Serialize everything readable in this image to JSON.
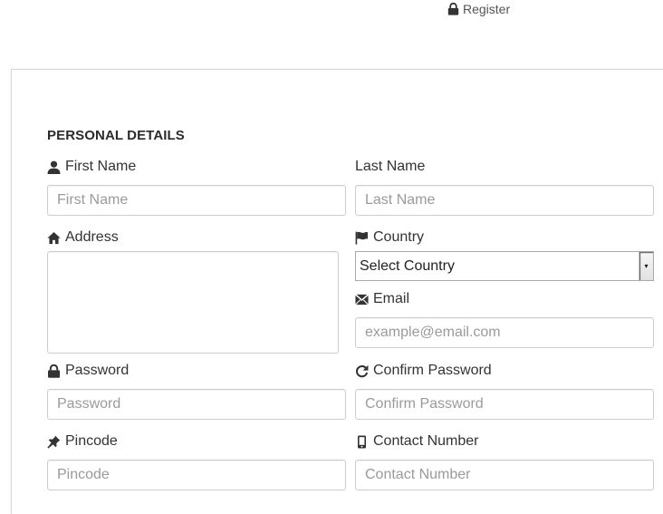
{
  "header": {
    "register_label": "Register",
    "register_icon": "lock-icon"
  },
  "form": {
    "section_title": "PERSONAL DETAILS",
    "first_name": {
      "label": "First Name",
      "placeholder": "First Name",
      "value": "",
      "icon": "user-icon"
    },
    "last_name": {
      "label": "Last Name",
      "placeholder": "Last Name",
      "value": ""
    },
    "address": {
      "label": "Address",
      "value": "",
      "icon": "home-icon"
    },
    "country": {
      "label": "Country",
      "selected": "Select Country",
      "icon": "flag-icon"
    },
    "email": {
      "label": "Email",
      "placeholder": "example@email.com",
      "value": "",
      "icon": "envelope-icon"
    },
    "password": {
      "label": "Password",
      "placeholder": "Password",
      "value": "",
      "icon": "lock-icon"
    },
    "confirm_password": {
      "label": "Confirm Password",
      "placeholder": "Confirm Password",
      "value": "",
      "icon": "refresh-icon"
    },
    "pincode": {
      "label": "Pincode",
      "placeholder": "Pincode",
      "value": "",
      "icon": "pushpin-icon"
    },
    "contact_number": {
      "label": "Contact Number",
      "placeholder": "Contact Number",
      "value": "",
      "icon": "phone-icon"
    }
  }
}
